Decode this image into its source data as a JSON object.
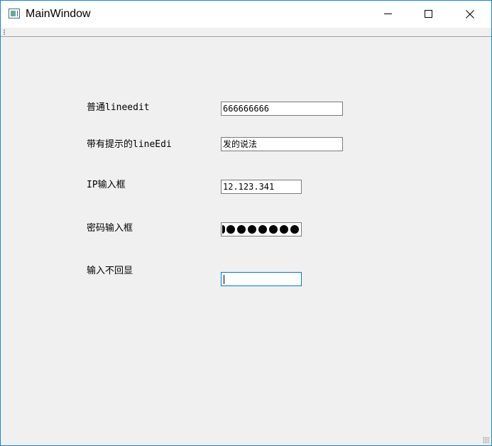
{
  "window": {
    "title": "MainWindow"
  },
  "form": {
    "normal": {
      "label": "普通lineedit",
      "value": "666666666"
    },
    "hint": {
      "label": "带有提示的lineEdi",
      "value": "发的说法"
    },
    "ip": {
      "label": "IP输入框",
      "value": " 12.123.341"
    },
    "password": {
      "label": "密码输入框",
      "masked_char_count": 8
    },
    "no_echo": {
      "label": "输入不回显",
      "value": ""
    }
  },
  "colors": {
    "window_border": "#1883d7",
    "background": "#f0f0f0",
    "focus_border": "#0078d7"
  },
  "icons": {
    "app": "app-window-icon",
    "minimize": "minimize-icon",
    "maximize": "maximize-icon",
    "close": "close-icon",
    "toolbar_handle": "toolbar-handle-icon",
    "size_grip": "size-grip-icon"
  }
}
